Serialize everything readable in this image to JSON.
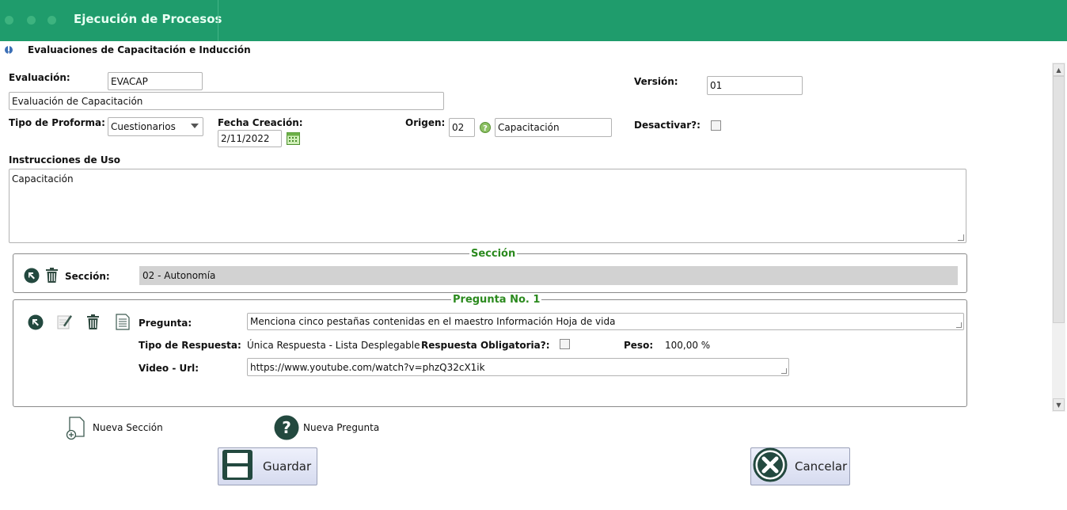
{
  "window": {
    "title": "Ejecución de Procesos",
    "subtitle": "Evaluaciones de Capacitación e Inducción",
    "accent": "#1f9c6c"
  },
  "form": {
    "evaluacion_label": "Evaluación:",
    "evaluacion_code": "EVACAP",
    "evaluacion_name": "Evaluación de Capacitación",
    "version_label": "Versión:",
    "version_value": "01",
    "tipo_proforma_label": "Tipo de Proforma:",
    "tipo_proforma_value": "Cuestionarios",
    "fecha_label": "Fecha Creación:",
    "fecha_value": "2/11/2022",
    "origen_label": "Origen:",
    "origen_code": "02",
    "origen_name": "Capacitación",
    "desactivar_label": "Desactivar?:",
    "desactivar_checked": false,
    "instrucciones_label": "Instrucciones de Uso",
    "instrucciones_value": "Capacitación"
  },
  "seccion": {
    "legend": "Sección",
    "label": "Sección:",
    "value": "02 - Autonomía"
  },
  "pregunta": {
    "legend": "Pregunta No. 1",
    "pregunta_label": "Pregunta:",
    "pregunta_value": "Menciona cinco pestañas contenidas en el maestro Información Hoja de vida",
    "tipo_label": "Tipo de Respuesta:",
    "tipo_value": "Única Respuesta - Lista Desplegable",
    "obligatoria_label": "Respuesta Obligatoria?:",
    "obligatoria_checked": false,
    "peso_label": "Peso:",
    "peso_value": "100,00 %",
    "video_label": "Video - Url:",
    "video_value": "https://www.youtube.com/watch?v=phzQ32cX1ik"
  },
  "actions": {
    "nueva_seccion": "Nueva Sección",
    "nueva_pregunta": "Nueva Pregunta",
    "guardar": "Guardar",
    "cancelar": "Cancelar"
  }
}
